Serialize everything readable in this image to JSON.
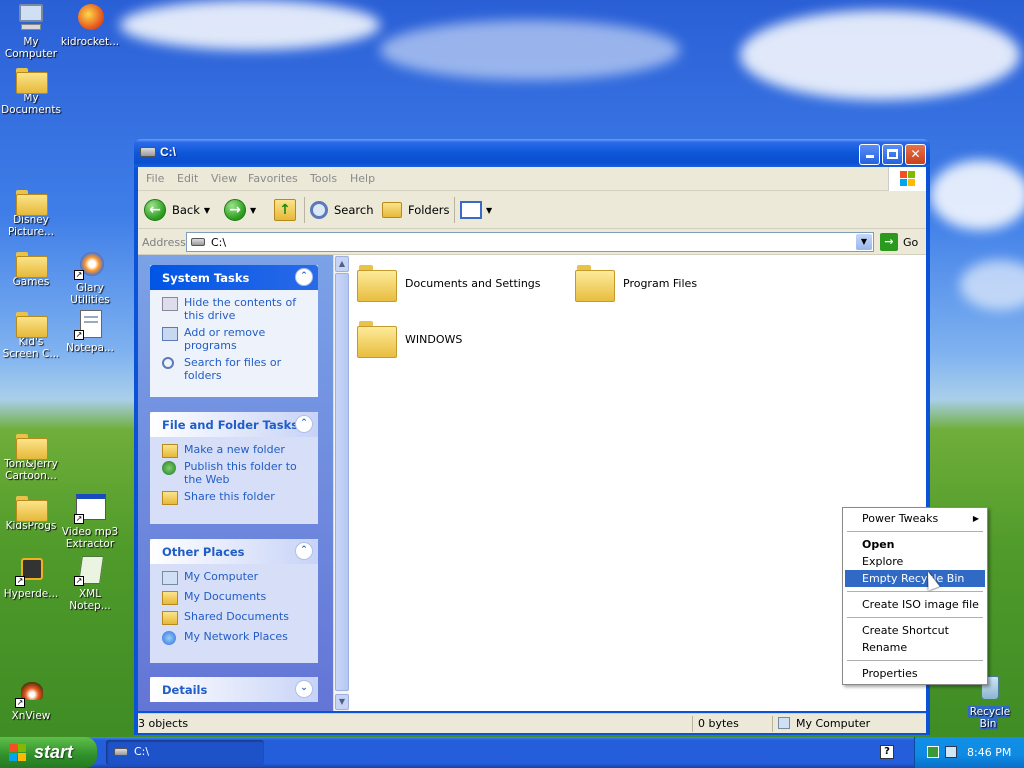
{
  "desktop": {
    "icons": [
      {
        "label": "My Computer"
      },
      {
        "label": "kidrocket..."
      },
      {
        "label": "My Documents"
      },
      {
        "label": "Disney Picture..."
      },
      {
        "label": "Games"
      },
      {
        "label": "Glary Utilities"
      },
      {
        "label": "Kid's Screen C..."
      },
      {
        "label": "Notepa..."
      },
      {
        "label": "Tom&Jerry Cartoon..."
      },
      {
        "label": "KidsProgs"
      },
      {
        "label": "Video mp3 Extractor"
      },
      {
        "label": "Hyperde..."
      },
      {
        "label": "XML Notep..."
      },
      {
        "label": "XnView"
      },
      {
        "label": "Recycle Bin"
      }
    ]
  },
  "window": {
    "title": "C:\\",
    "menu": [
      "File",
      "Edit",
      "View",
      "Favorites",
      "Tools",
      "Help"
    ],
    "toolbar": {
      "back": "Back",
      "search": "Search",
      "folders": "Folders"
    },
    "address": {
      "label": "Address",
      "value": "C:\\",
      "go": "Go"
    },
    "tasks": {
      "system": {
        "title": "System Tasks",
        "items": [
          "Hide the contents of this drive",
          "Add or remove programs",
          "Search for files or folders"
        ]
      },
      "file_folder": {
        "title": "File and Folder Tasks",
        "items": [
          "Make a new folder",
          "Publish this folder to the Web",
          "Share this folder"
        ]
      },
      "other_places": {
        "title": "Other Places",
        "items": [
          "My Computer",
          "My Documents",
          "Shared Documents",
          "My Network Places"
        ]
      },
      "details": {
        "title": "Details"
      }
    },
    "files": [
      "Documents and Settings",
      "Program Files",
      "WINDOWS"
    ],
    "status": {
      "objects": "3 objects",
      "size": "0 bytes",
      "location": "My Computer"
    }
  },
  "context_menu": {
    "items": [
      "Power Tweaks",
      "Open",
      "Explore",
      "Empty Recycle Bin",
      "Create ISO image file",
      "Create Shortcut",
      "Rename",
      "Properties"
    ]
  },
  "taskbar": {
    "start": "start",
    "task": "C:\\",
    "clock": "8:46 PM"
  },
  "colors": {
    "title_blue": "#0a53d6",
    "link_blue": "#215dc6",
    "selection": "#316ac5",
    "start_green": "#2f8f2a"
  }
}
